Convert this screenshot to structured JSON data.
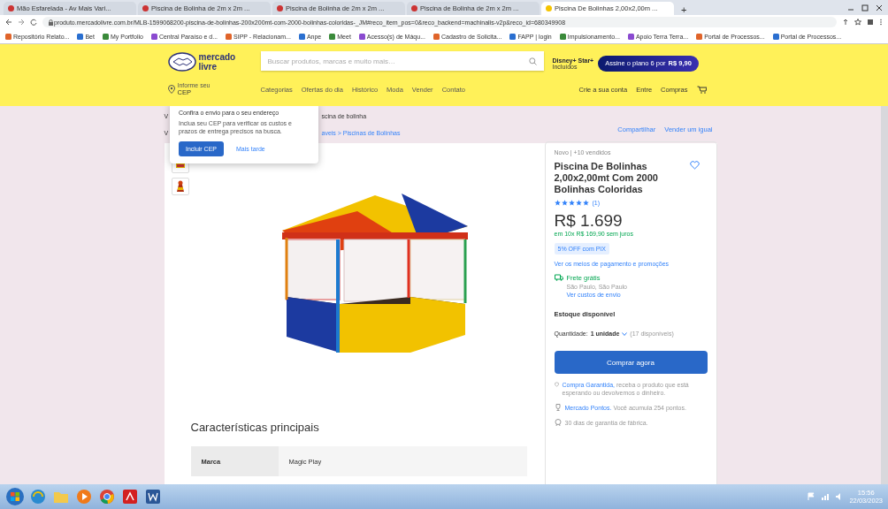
{
  "browser": {
    "tabs": [
      {
        "label": "Mão Esfarelada - Av Mais Vari...",
        "selected": false
      },
      {
        "label": "Piscina de Bolinha de 2m x 2m ...",
        "selected": false
      },
      {
        "label": "Piscina de Bolinha de 2m x 2m ...",
        "selected": false
      },
      {
        "label": "Piscina de Bolinha de 2m x 2m ...",
        "selected": false
      },
      {
        "label": "Piscina De Bolinhas 2,00x2,00m ...",
        "selected": true
      }
    ],
    "new_tab": "+",
    "url": "produto.mercadolivre.com.br/MLB-1599068200-piscina-de-bolinhas-200x200mt-com-2000-bolinhas-coloridas-_JM#reco_item_pos=0&reco_backend=machinalis-v2p&reco_id=680349908",
    "bookmarks": [
      "Repositório Relato...",
      "Bet",
      "My Portfolio",
      "Central Paraíso e d...",
      "SIPP - Relacionam...",
      "Anpe",
      "Meet",
      "Acesso(s) de Máqu...",
      "Cadastro de Solicita...",
      "FAPP | login",
      "Impulsionamento...",
      "Apoio Terra Terra...",
      "Portal de Processos...",
      "Portal de Processos..."
    ]
  },
  "header": {
    "logo": "mercado livre",
    "search": {
      "placeholder": "Buscar produtos, marcas e muito mais…"
    },
    "location": {
      "line_1": "Informe seu",
      "line_2": "CEP"
    },
    "promo": {
      "brand": "Disney+ Star+",
      "caption": "Incluídos",
      "offer": "Assine o plano 6 por",
      "price": "R$ 9,90"
    },
    "nav": [
      "Categorias",
      "Ofertas do dia",
      "Histórico",
      "Moda",
      "Vender",
      "Contato"
    ],
    "account": [
      "Crie a sua conta",
      "Entre",
      "Compras"
    ]
  },
  "popover": {
    "title": "Confira o envio para o seu endereço",
    "text": "Inclua seu CEP para verificar os custos e prazos de entrega precisos na busca.",
    "primary": "Incluir CEP",
    "secondary": "Mais tarde"
  },
  "breadcrumb": {
    "line_1": {
      "start": "V",
      "end": "scina de bolinha"
    },
    "line_2": {
      "start": "V",
      "end": "aveis > Piscinas de Bolinhas"
    }
  },
  "actions": [
    "Compartilhar",
    "Vender um igual"
  ],
  "product": {
    "condition": "Novo | +10 vendidos",
    "title": "Piscina De Bolinhas 2,00x2,00mt Com 2000 Bolinhas Coloridas",
    "favorite": false,
    "stars": 5,
    "reviews": "(1)",
    "price": "R$ 1.699",
    "installments": "em 10x R$ 169,90 sem juros",
    "discount": "5% OFF com PIX",
    "payment_link": "Ver os meios de pagamento e promoções",
    "shipping": {
      "title": "Frete grátis",
      "place": "São Paulo, São Paulo",
      "link": "Ver custos de envio"
    },
    "stock": "Estoque disponível",
    "quantity": {
      "label": "Quantidade:",
      "value": "1 unidade",
      "available": "(17 disponíveis)"
    },
    "buy": "Comprar agora",
    "benefits": [
      {
        "kind": "shield",
        "link": "Compra Garantida,",
        "text": "receba o produto que está esperando ou devolvemos o dinheiro."
      },
      {
        "kind": "trophy",
        "link": "Mercado Pontos.",
        "text": "Você acumula 254 pontos."
      },
      {
        "kind": "badge",
        "text": "30 dias de garantia de fábrica."
      }
    ]
  },
  "features": {
    "title": "Características principais",
    "rows": [
      {
        "key": "Marca",
        "value": "Magic Play"
      }
    ]
  },
  "taskbar": {
    "time": "15:56",
    "date": "22/03/2023"
  }
}
